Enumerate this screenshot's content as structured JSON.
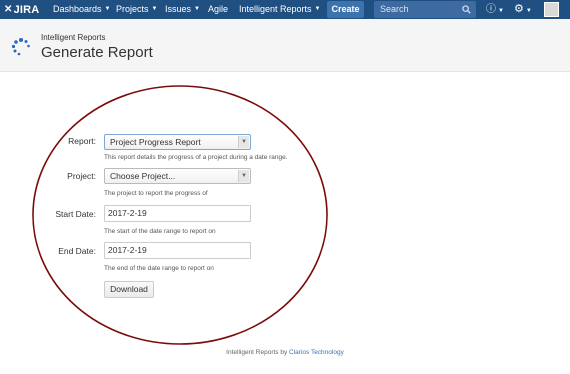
{
  "topbar": {
    "logo_text": "JIRA",
    "nav": [
      {
        "label": "Dashboards"
      },
      {
        "label": "Projects"
      },
      {
        "label": "Issues"
      },
      {
        "label": "Agile"
      },
      {
        "label": "Intelligent Reports"
      }
    ],
    "create_label": "Create",
    "search_placeholder": "Search",
    "help_icon": "help-icon",
    "settings_icon": "gear-icon"
  },
  "header": {
    "breadcrumb": "Intelligent Reports",
    "title": "Generate Report"
  },
  "form": {
    "report": {
      "label": "Report:",
      "value": "Project Progress Report",
      "help": "This report details the progress of a project during a date range."
    },
    "project": {
      "label": "Project:",
      "value": "Choose Project...",
      "help": "The project to report the progress of"
    },
    "start_date": {
      "label": "Start Date:",
      "value": "2017-2-19",
      "help": "The start of the date range to report on"
    },
    "end_date": {
      "label": "End Date:",
      "value": "2017-2-19",
      "help": "The end of the date range to report on"
    },
    "download_label": "Download"
  },
  "footer": {
    "prefix": "Intelligent Reports by",
    "link": "Clarios Technology"
  },
  "colors": {
    "topbar": "#205081",
    "create_button": "#3b73af",
    "annotation_ellipse": "#7a0c0c",
    "link": "#3b73af"
  }
}
